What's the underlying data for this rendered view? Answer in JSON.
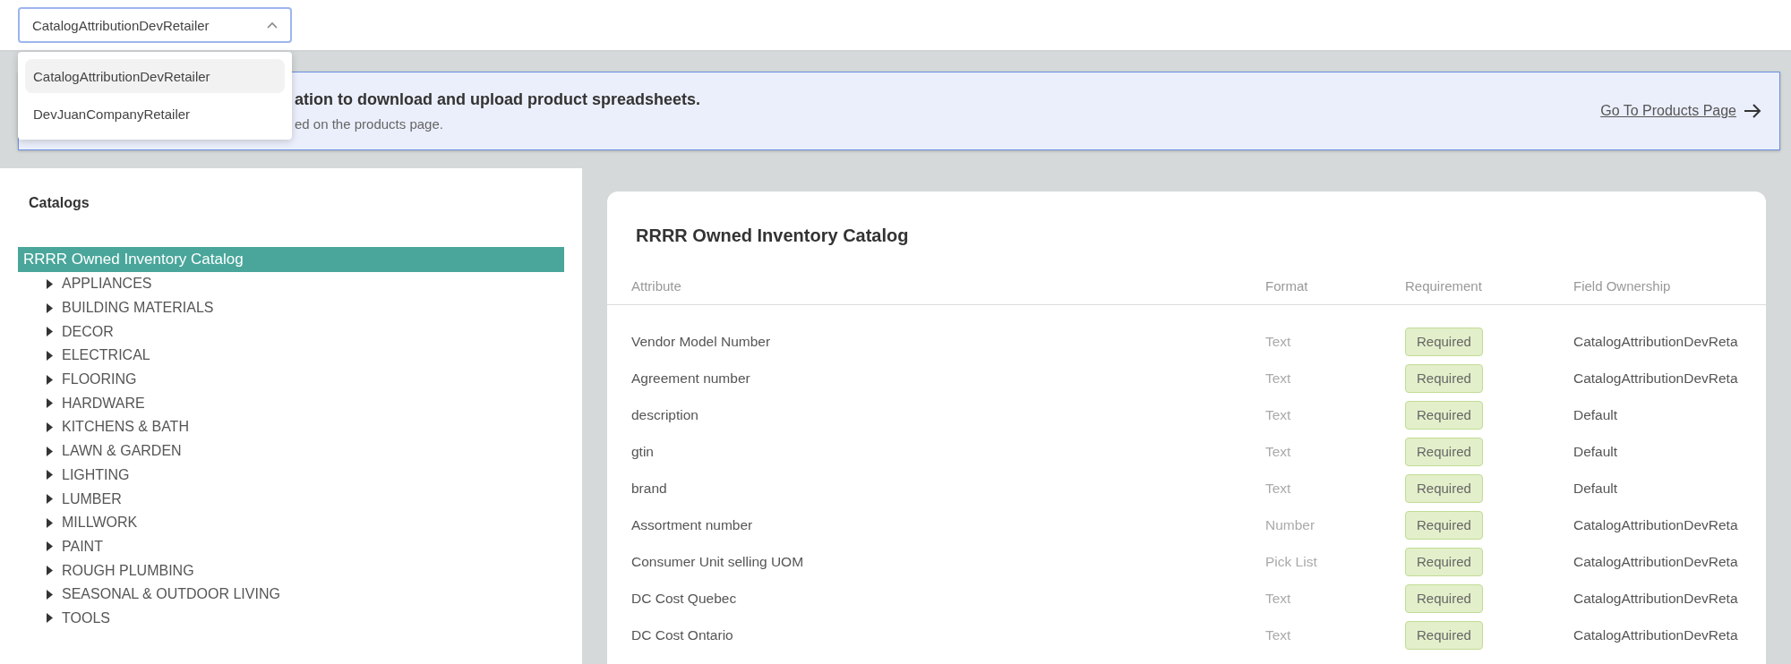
{
  "retailer_select": {
    "value": "CatalogAttributionDevRetailer",
    "expanded": true,
    "options": [
      {
        "label": "CatalogAttributionDevRetailer",
        "selected": true
      },
      {
        "label": "DevJuanCompanyRetailer",
        "selected": false
      }
    ]
  },
  "banner": {
    "title": "ation to download and upload product spreadsheets.",
    "subtitle": "ed on the products page.",
    "link": "Go To Products Page"
  },
  "sidebar": {
    "title": "Catalogs",
    "tree": [
      {
        "label": "RRRR Owned Inventory Catalog",
        "selected": true,
        "children": [
          {
            "label": "APPLIANCES",
            "selected": false,
            "expanded": false
          },
          {
            "label": "BUILDING MATERIALS",
            "selected": false,
            "expanded": false
          },
          {
            "label": "DECOR",
            "selected": false,
            "expanded": false
          },
          {
            "label": "ELECTRICAL",
            "selected": false,
            "expanded": false
          },
          {
            "label": "FLOORING",
            "selected": false,
            "expanded": false
          },
          {
            "label": "HARDWARE",
            "selected": false,
            "expanded": false
          },
          {
            "label": "KITCHENS & BATH",
            "selected": false,
            "expanded": false
          },
          {
            "label": "LAWN & GARDEN",
            "selected": false,
            "expanded": false
          },
          {
            "label": "LIGHTING",
            "selected": false,
            "expanded": false
          },
          {
            "label": "LUMBER",
            "selected": false,
            "expanded": false
          },
          {
            "label": "MILLWORK",
            "selected": false,
            "expanded": false
          },
          {
            "label": "PAINT",
            "selected": false,
            "expanded": false
          },
          {
            "label": "ROUGH PLUMBING",
            "selected": false,
            "expanded": false
          },
          {
            "label": "SEASONAL & OUTDOOR LIVING",
            "selected": false,
            "expanded": false
          },
          {
            "label": "TOOLS",
            "selected": false,
            "expanded": false
          }
        ]
      }
    ]
  },
  "catalog": {
    "title": "RRRR Owned Inventory Catalog",
    "columns": [
      "Attribute",
      "Format",
      "Requirement",
      "Field Ownership"
    ],
    "rows": [
      {
        "attribute": "Vendor Model Number",
        "format": "Text",
        "requirement": "Required",
        "ownership": "CatalogAttributionDevReta"
      },
      {
        "attribute": "Agreement number",
        "format": "Text",
        "requirement": "Required",
        "ownership": "CatalogAttributionDevReta"
      },
      {
        "attribute": "description",
        "format": "Text",
        "requirement": "Required",
        "ownership": "Default"
      },
      {
        "attribute": "gtin",
        "format": "Text",
        "requirement": "Required",
        "ownership": "Default"
      },
      {
        "attribute": "brand",
        "format": "Text",
        "requirement": "Required",
        "ownership": "Default"
      },
      {
        "attribute": "Assortment number",
        "format": "Number",
        "requirement": "Required",
        "ownership": "CatalogAttributionDevReta"
      },
      {
        "attribute": "Consumer Unit selling UOM",
        "format": "Pick List",
        "requirement": "Required",
        "ownership": "CatalogAttributionDevReta"
      },
      {
        "attribute": "DC Cost Quebec",
        "format": "Text",
        "requirement": "Required",
        "ownership": "CatalogAttributionDevReta"
      },
      {
        "attribute": "DC Cost Ontario",
        "format": "Text",
        "requirement": "Required",
        "ownership": "CatalogAttributionDevReta"
      }
    ]
  }
}
